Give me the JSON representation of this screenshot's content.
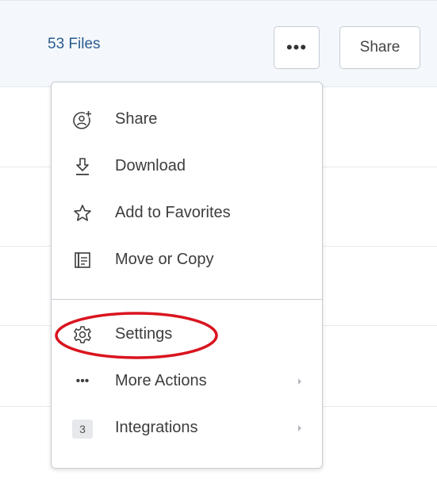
{
  "header": {
    "file_count": "53 Files",
    "more_button_label": "•••",
    "share_button_label": "Share"
  },
  "menu": {
    "items": [
      {
        "label": "Share",
        "icon": "share-person-icon"
      },
      {
        "label": "Download",
        "icon": "download-icon"
      },
      {
        "label": "Add to Favorites",
        "icon": "star-icon"
      },
      {
        "label": "Move or Copy",
        "icon": "move-copy-icon"
      },
      {
        "label": "Settings",
        "icon": "gear-icon"
      },
      {
        "label": "More Actions",
        "icon": "ellipsis-icon"
      },
      {
        "label": "Integrations",
        "icon": "badge-count",
        "badge": "3"
      }
    ],
    "more_actions_dots": "•••"
  },
  "annotation": {
    "highlight_color": "#d9141f"
  },
  "colors": {
    "header_bg": "#f4f8fc",
    "file_count_text": "#2a5b8f",
    "menu_text": "#3d3d3d"
  }
}
